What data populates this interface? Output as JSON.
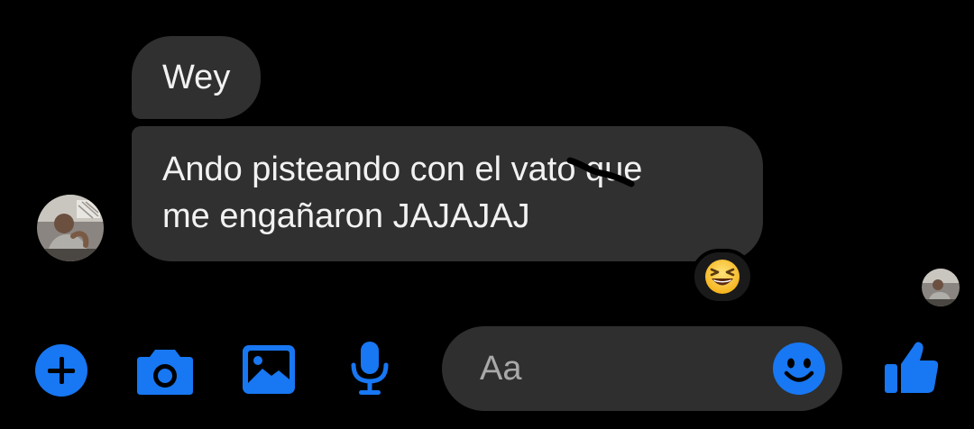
{
  "conversation": {
    "messages": [
      {
        "lines": [
          "Wey"
        ]
      },
      {
        "lines": [
          "Ando pisteando con el vato que",
          "me engañaron JAJAJAJ"
        ]
      }
    ],
    "reaction": {
      "emoji": "grinning-squinting-face"
    },
    "sender_avatar": "avatar-photo",
    "seen_avatar": "avatar-photo"
  },
  "composer": {
    "placeholder": "Aa",
    "buttons": [
      "plus-icon",
      "camera-icon",
      "image-icon",
      "microphone-icon",
      "emoji-icon",
      "thumbs-up-icon"
    ]
  },
  "colors": {
    "background": "#000000",
    "bubble": "#303030",
    "accent": "#1877F2",
    "input_background": "#2f2f2f",
    "placeholder": "#a9a9a9"
  }
}
